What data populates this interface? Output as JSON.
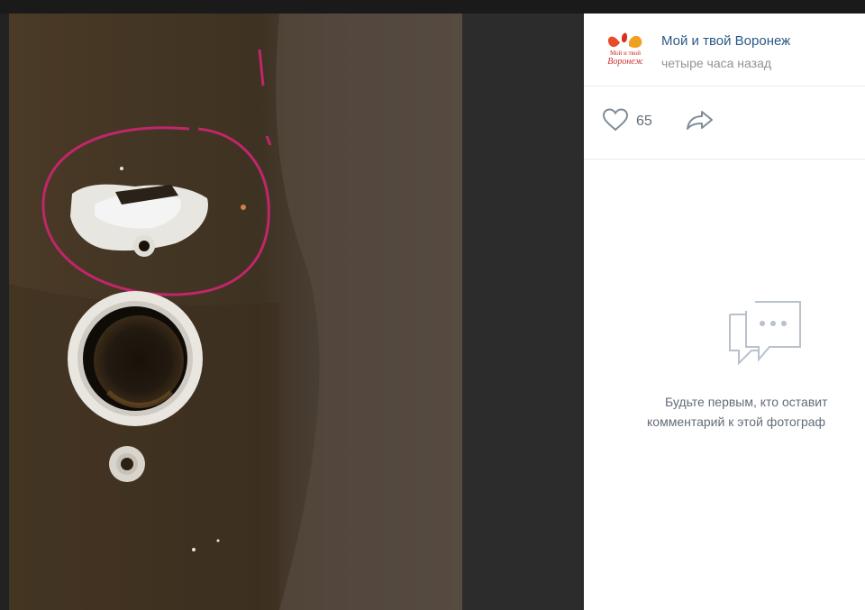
{
  "post": {
    "author": "Мой и твой Воронеж",
    "time": "четыре часа назад",
    "avatar_text_top": "Мой и твой",
    "avatar_text_bottom": "Воронеж"
  },
  "actions": {
    "like_count": "65",
    "like_icon": "heart-outline-icon",
    "share_icon": "share-arrow-icon"
  },
  "comments": {
    "empty_icon": "chat-bubbles-icon",
    "empty_line1": "Будьте первым, кто оставит",
    "empty_line2": "комментарий к этой фотограф"
  },
  "colors": {
    "link": "#2a5885",
    "muted": "#939393",
    "annotation": "#c0266a"
  }
}
